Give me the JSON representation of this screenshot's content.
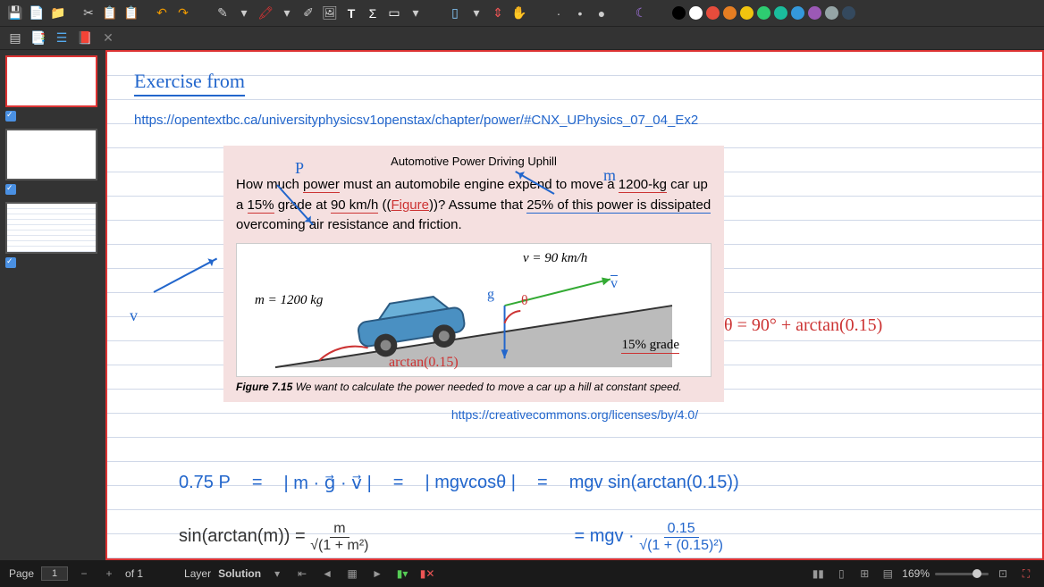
{
  "toolbar": {
    "save": "💾",
    "new": "📄",
    "open": "📁",
    "cut": "✂",
    "copy": "📋",
    "paste": "📋",
    "undo": "↶",
    "redo": "↷",
    "pen": "✎",
    "hl": "🖍",
    "eraser": "✐",
    "img": "🖼",
    "text": "T",
    "sum": "Σ",
    "rect": "▭",
    "sel": "▯",
    "vsel": "⇕",
    "hand": "✋",
    "dot1": "·",
    "dot2": "•",
    "dot3": "●",
    "moon": "☾"
  },
  "swatches": [
    "#000",
    "#fff",
    "#e74c3c",
    "#e67e22",
    "#f1c40f",
    "#2ecc71",
    "#1abc9c",
    "#3498db",
    "#9b59b6",
    "#95a5a6",
    "#34495e"
  ],
  "title": "Exercise from",
  "source_url": "https://opentextbc.ca/universityphysicsv1openstax/chapter/power/#CNX_UPhysics_07_04_Ex2",
  "problem": {
    "heading": "Automotive Power Driving Uphill",
    "t1": "How much ",
    "t2": "power",
    "t3": " must an automobile engine expend to move a ",
    "t4": "1200-kg",
    "t5": " car up a ",
    "t6": "15%",
    "t7": " grade at ",
    "t8": "90 km/h",
    "t9": " ((",
    "link": "Figure",
    "t10": "))? Assume that ",
    "t11": "25% of this power is dissipated",
    "t12": " overcoming air resistance and friction.",
    "v_label": "v = 90 km/h",
    "m_label": "m = 1200 kg",
    "grade_label": "15% grade",
    "caption_b": "Figure 7.15",
    "caption": " We want to calculate the power needed to move a car up a hill at constant speed."
  },
  "cc_url": "https://creativecommons.org/licenses/by/4.0/",
  "ann": {
    "P": "P",
    "m": "m",
    "v": "v",
    "V": "v",
    "g": "g",
    "theta": "θ",
    "arctan": "arctan(0.15)"
  },
  "theta_eq": "θ = 90° + arctan(0.15)",
  "eq1": {
    "lhs": "0.75 P",
    "eq": "=",
    "t1": "| m · g⃗ · v⃗ |",
    "t2": "| mgvcosθ |",
    "t3": "mgv sin(arctan(0.15))"
  },
  "eq2": {
    "serif": "sin(arctan(m)) = ",
    "num": "m",
    "den": "√(1 + m²)",
    "rhs_pre": "= mgv · ",
    "rnum": "0.15",
    "rden": "√(1 + (0.15)²)"
  },
  "status": {
    "page_lbl": "Page",
    "page": "1",
    "of": "of 1",
    "layer_lbl": "Layer",
    "layer": "Solution",
    "zoom": "169%"
  }
}
